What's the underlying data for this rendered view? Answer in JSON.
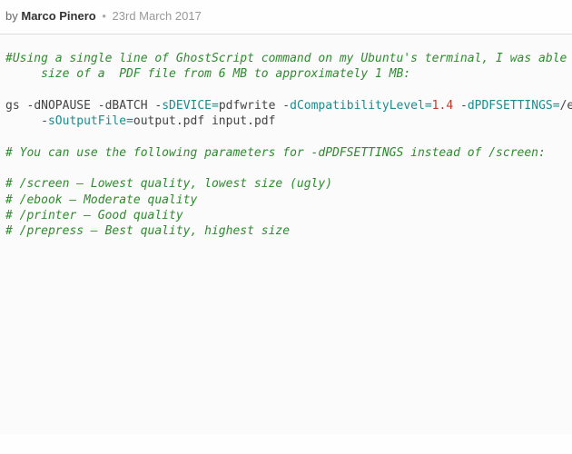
{
  "meta": {
    "by_label": "by",
    "author": "Marco Pinero",
    "dot": "•",
    "date": "23rd March 2017"
  },
  "code": {
    "c1a": "#Using a single line of GhostScript command on my Ubuntu's terminal, I was able",
    "c1b": "     size of a  PDF file from 6 MB to approximately 1 MB:",
    "cmd_prefix": "gs ",
    "d1": "-",
    "f_nopause": "dNOPAUSE ",
    "d2": "-",
    "f_batch": "dBATCH ",
    "d3": "-",
    "f_sdevice": "sDEVICE",
    "eq1": "=",
    "v_pdfwrite": "pdfwrite ",
    "d4": "-",
    "f_compat": "dCompatibilityLevel",
    "eq2": "=",
    "v_one": "1",
    "v_dot": ".",
    "v_four": "4",
    "sp1": " ",
    "d5": "-",
    "f_pdfset": "dPDFSETTINGS",
    "eq3": "=",
    "v_slash": "/",
    "v_e": "e",
    "indent": "     ",
    "d6": "-",
    "f_outfile": "sOutputFile",
    "eq4": "=",
    "v_outin": "output.pdf input.pdf",
    "c3": "# You can use the following parameters for -dPDFSETTINGS instead of /screen:",
    "c4": "# /screen – Lowest quality, lowest size (ugly)",
    "c5": "# /ebook – Moderate quality",
    "c6": "# /printer – Good quality",
    "c7": "# /prepress – Best quality, highest size"
  }
}
